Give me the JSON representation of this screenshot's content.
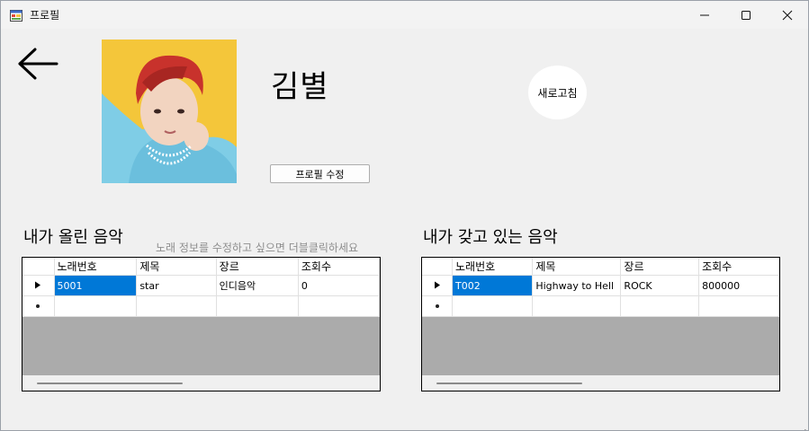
{
  "window": {
    "title": "프로필"
  },
  "profile": {
    "name": "김별",
    "refresh_label": "새로고침",
    "edit_label": "프로필 수정"
  },
  "uploaded": {
    "title": "내가 올린 음악",
    "hint": "노래 정보를 수정하고 싶으면 더블클릭하세요",
    "columns": [
      "노래번호",
      "제목",
      "장르",
      "조회수"
    ],
    "rows": [
      {
        "c0": "5001",
        "c1": "star",
        "c2": "인디음악",
        "c3": "0"
      }
    ]
  },
  "owned": {
    "title": "내가 갖고 있는 음악",
    "columns": [
      "노래번호",
      "제목",
      "장르",
      "조회수"
    ],
    "rows": [
      {
        "c0": "T002",
        "c1": "Highway to Hell",
        "c2": "ROCK",
        "c3": "800000"
      }
    ]
  },
  "colors": {
    "selection": "#0078d7",
    "grid_empty": "#ababab",
    "window_bg": "#f0f0f0"
  },
  "icons": {
    "back": "arrow-left-icon",
    "app": "app-icon",
    "current_row": "triangle-right-icon",
    "new_row": "asterisk-icon"
  }
}
